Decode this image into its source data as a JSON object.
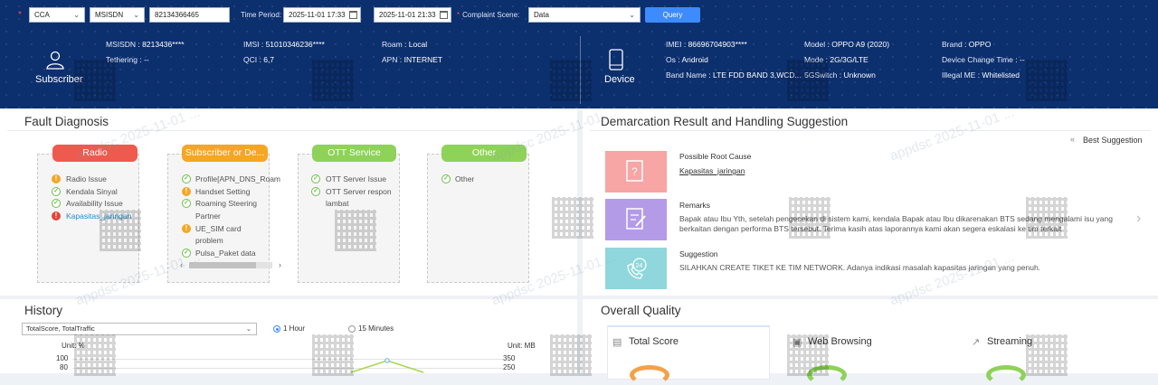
{
  "query": {
    "type": "CCA",
    "id_type": "MSISDN",
    "id_value": "82134366465",
    "time_period_label": "Time Period:",
    "start_time": "2025-11-01 17:33",
    "end_time": "2025-11-01 21:33",
    "scene_label": "Complaint Scene:",
    "scene_value": "Data",
    "query_button": "Query"
  },
  "subscriber": {
    "label": "Subscriber",
    "fields": [
      {
        "k": "MSISDN",
        "v": "8213436****"
      },
      {
        "k": "IMSI",
        "v": "51010346236****"
      },
      {
        "k": "Roam",
        "v": "Local"
      },
      {
        "k": "Tethering",
        "v": "--"
      },
      {
        "k": "QCI",
        "v": "6,7"
      },
      {
        "k": "APN",
        "v": "INTERNET"
      }
    ]
  },
  "device": {
    "label": "Device",
    "fields": [
      {
        "k": "IMEI",
        "v": "86696704903****"
      },
      {
        "k": "Model",
        "v": "OPPO A9 (2020)"
      },
      {
        "k": "Brand",
        "v": "OPPO"
      },
      {
        "k": "Os",
        "v": "Android"
      },
      {
        "k": "Mode",
        "v": "2G/3G/LTE"
      },
      {
        "k": "Device Change Time",
        "v": "--"
      },
      {
        "k": "Band Name",
        "v": "LTE FDD BAND 3,WCD..."
      },
      {
        "k": "5GSwitch",
        "v": "Unknown"
      },
      {
        "k": "Illegal ME",
        "v": "Whitelisted"
      }
    ]
  },
  "fault": {
    "title": "Fault Diagnosis",
    "categories": [
      {
        "name": "Radio",
        "color": "#ee5a4e",
        "items": [
          {
            "status": "warn",
            "label": "Radio Issue"
          },
          {
            "status": "ok",
            "label": "Kendala Sinyal"
          },
          {
            "status": "ok",
            "label": "Availability Issue"
          },
          {
            "status": "err",
            "label": "Kapasitas_jaringan"
          }
        ]
      },
      {
        "name": "Subscriber or De...",
        "color": "#f5a623",
        "items": [
          {
            "status": "ok",
            "label": "Profile[APN_DNS_Roam"
          },
          {
            "status": "warn",
            "label": "Handset Setting"
          },
          {
            "status": "ok",
            "label": "Roaming Steering"
          },
          {
            "status": "none",
            "label": "Partner"
          },
          {
            "status": "warn",
            "label": "UE_SIM card"
          },
          {
            "status": "none",
            "label": "problem"
          },
          {
            "status": "ok",
            "label": "Pulsa_Paket data"
          }
        ]
      },
      {
        "name": "OTT Service",
        "color": "#8ed25a",
        "items": [
          {
            "status": "ok",
            "label": "OTT Server Issue"
          },
          {
            "status": "ok",
            "label": "OTT Server respon"
          },
          {
            "status": "none",
            "label": "lambat"
          }
        ]
      },
      {
        "name": "Other",
        "color": "#8ed25a",
        "items": [
          {
            "status": "ok",
            "label": "Other"
          }
        ]
      }
    ]
  },
  "demarcation": {
    "title": "Demarcation Result and Handling Suggestion",
    "best_suggestion": "Best Suggestion",
    "root_cause_title": "Possible Root Cause",
    "root_cause_link": "Kapasitas_jaringan",
    "remarks_title": "Remarks",
    "remarks_text": "Bapak atau Ibu Yth, setelah pengecekan di sistem kami, kendala Bapak atau Ibu dikarenakan BTS sedang mengalami isu yang berkaitan dengan performa BTS tersebut. Terima kasih atas laporannya kami akan segera eskalasi ke tim terkait",
    "suggestion_title": "Suggestion",
    "suggestion_text": "SILAHKAN CREATE TIKET KE TIM NETWORK. Adanya indikasi masalah kapasitas jaringan yang penuh."
  },
  "history": {
    "title": "History",
    "select_value": "TotalScore, TotalTraffic",
    "radio_1h": "1 Hour",
    "radio_15m": "15 Minutes",
    "unit_left": "Unit: %",
    "unit_right": "Unit: MB",
    "left_ticks": [
      "100",
      "80"
    ],
    "right_ticks": [
      "350",
      "250"
    ]
  },
  "overall": {
    "title": "Overall Quality",
    "cards": [
      "Total Score",
      "Web Browsing",
      "Streaming"
    ]
  },
  "watermark": "appdsc 2025-11-01 ..."
}
